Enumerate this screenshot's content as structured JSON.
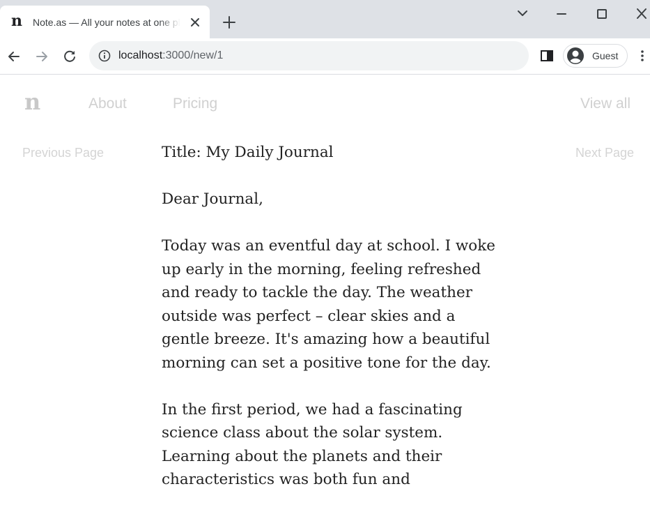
{
  "browser": {
    "tab": {
      "favicon_glyph": "n",
      "title": "Note.as — All your notes at one place"
    },
    "address_bar": {
      "host": "localhost",
      "path": ":3000/new/1"
    },
    "profile": {
      "name": "Guest"
    },
    "icons": [
      "chevron-down-icon",
      "minimize-icon",
      "maximize-icon",
      "close-icon",
      "plus-icon",
      "back-arrow-icon",
      "forward-arrow-icon",
      "reload-icon",
      "info-icon",
      "side-panel-icon",
      "avatar-icon",
      "kebab-menu-icon"
    ]
  },
  "site": {
    "logo": "n",
    "nav": {
      "about": "About",
      "pricing": "Pricing",
      "view_all": "View all"
    },
    "pager": {
      "previous": "Previous Page",
      "next": "Next Page"
    }
  },
  "note": {
    "paragraphs": [
      "Title: My Daily Journal",
      "Dear Journal,",
      "Today was an eventful day at school. I woke up early in the morning, feeling refreshed and ready to tackle the day. The weather outside was perfect – clear skies and a gentle breeze. It's amazing how a beautiful morning can set a positive tone for the day.",
      "In the first period, we had a fascinating science class about the solar system. Learning about the planets and their characteristics was both fun and"
    ]
  },
  "colors": {
    "tabstrip_bg": "#dee1e6",
    "omnibox_bg": "#f1f3f4",
    "nav_muted": "#d0d0d0",
    "body_text": "#222222"
  }
}
